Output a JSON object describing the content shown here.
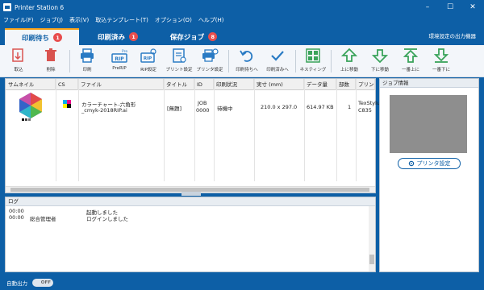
{
  "window": {
    "title": "Printer Station 6"
  },
  "menu": [
    "ファイル(F)",
    "ジョブ(J)",
    "表示(V)",
    "取込テンプレート(T)",
    "オプション(O)",
    "ヘルプ(H)"
  ],
  "tabs": [
    {
      "label": "印刷待ち",
      "count": "1"
    },
    {
      "label": "印刷済み",
      "count": "1"
    },
    {
      "label": "保存ジョブ",
      "count": "8"
    }
  ],
  "env_label": "環境設定の出力機器",
  "toolbar": {
    "import": "取込",
    "delete": "削除",
    "print": "印刷",
    "prerip": "PreRIP",
    "rip_settings": "RIP設定",
    "print_settings": "プリント設定",
    "printer_settings": "プリンタ設定",
    "to_waiting": "印刷待ちへ",
    "to_done": "印刷済みへ",
    "nesting": "ネスティング",
    "move_up": "上に移動",
    "move_down": "下に移動",
    "move_top": "一番上に",
    "move_bottom": "一番下に"
  },
  "table": {
    "headers": [
      "サムネイル",
      "CS",
      "ファイル",
      "タイトル",
      "ID",
      "印刷状況",
      "実寸 (mm)",
      "データ量",
      "部数",
      "プリンタ"
    ],
    "rows": [
      {
        "file_line1": "カラーチャート-六角形",
        "file_line2": "_cmyk-2018RIP.ai",
        "title": "[無題]",
        "id_line1": "JOB",
        "id_line2": "0000",
        "status": "待機中",
        "size": "210.0 x 297.0",
        "data": "614.97 KB",
        "copies": "1",
        "printer_line1": "TexStylus",
        "printer_line2": "C835"
      }
    ]
  },
  "log": {
    "header": "ログ",
    "entries": [
      {
        "time": "00:00",
        "user": "",
        "message": "起動しました"
      },
      {
        "time": "00:00",
        "user": "総合管理者",
        "message": "ログインしました"
      }
    ]
  },
  "job_info": {
    "header": "ジョブ情報",
    "printer_button": "プリンタ設定"
  },
  "status": {
    "auto_output_label": "自動出力",
    "auto_output_state": "OFF"
  },
  "colors": {
    "brand": "#0d5fa6",
    "accent": "#f7a21b",
    "badge": "#e84d4d",
    "icon_red": "#d9534f",
    "icon_blue": "#2a7bc4",
    "icon_green": "#3aa35a"
  }
}
